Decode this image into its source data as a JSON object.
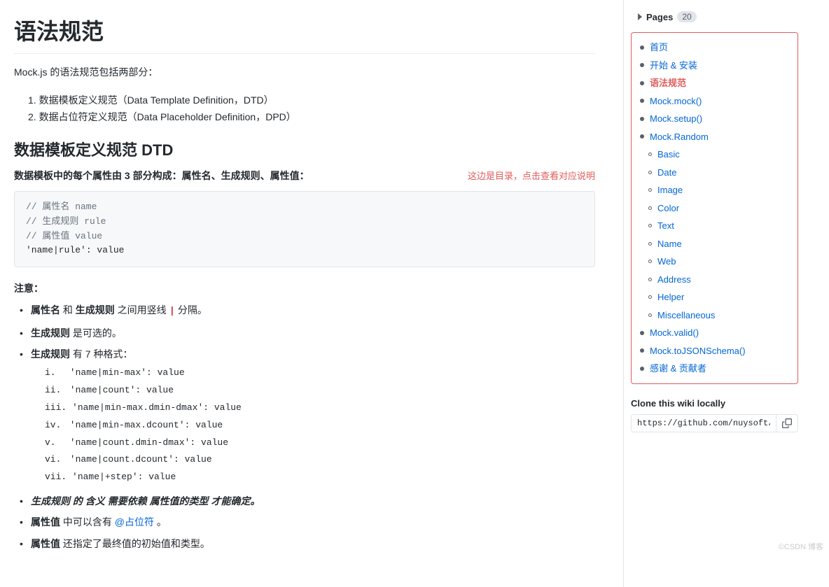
{
  "page": {
    "title": "语法规范",
    "intro": "Mock.js 的语法规范包括两部分：",
    "intro_items": [
      "1. 数据模板定义规范（Data Template Definition，DTD）",
      "2. 数据占位符定义规范（Data Placeholder Definition，DPD）"
    ],
    "section1_title": "数据模板定义规范 DTD",
    "section1_highlight": "数据模板中的每个属性由 3 部分构成：属性名、生成规则、属性值：",
    "toc_hint": "这边是目录，点击查看对应说明",
    "code_lines": [
      "// 属性名   name",
      "// 生成规则 rule",
      "// 属性值   value",
      "'name|rule': value"
    ],
    "note_label": "注意：",
    "notes": [
      "属性名 和 生成规则 之间用竖线 | 分隔。",
      "生成规则 是可选的。",
      "生成规则 有 7 种格式："
    ],
    "rule_formats": [
      {
        "roman": "i.",
        "code": "'name|min-max': value"
      },
      {
        "roman": "ii.",
        "code": "'name|count': value"
      },
      {
        "roman": "iii.",
        "code": "'name|min-max.dmin-dmax': value"
      },
      {
        "roman": "iv.",
        "code": "'name|min-max.dcount': value"
      },
      {
        "roman": "v.",
        "code": "'name|count.dmin-dmax': value"
      },
      {
        "roman": "vi.",
        "code": "'name|count.dcount': value"
      },
      {
        "roman": "vii.",
        "code": "'name|+step': value"
      }
    ],
    "notes2": [
      {
        "text": "生成规则 的 含义 需要依赖 属性值的类型 才能确定。",
        "italic": true
      },
      {
        "text": "属性值 中可以含有 @占位符 。",
        "italic": false
      },
      {
        "text": "属性值 还指定了最终值的初始值和类型。",
        "italic": false
      }
    ]
  },
  "sidebar": {
    "pages_label": "Pages",
    "pages_count": "20",
    "nav_items": [
      {
        "id": "home",
        "label": "首页",
        "level": "top",
        "active": false
      },
      {
        "id": "start",
        "label": "开始 & 安装",
        "level": "top",
        "active": false
      },
      {
        "id": "syntax",
        "label": "语法规范",
        "level": "top",
        "active": true
      },
      {
        "id": "mock-mock",
        "label": "Mock.mock()",
        "level": "top",
        "active": false
      },
      {
        "id": "mock-setup",
        "label": "Mock.setup()",
        "level": "top",
        "active": false
      },
      {
        "id": "mock-random",
        "label": "Mock.Random",
        "level": "top",
        "active": false
      },
      {
        "id": "basic",
        "label": "Basic",
        "level": "sub",
        "active": false
      },
      {
        "id": "date",
        "label": "Date",
        "level": "sub",
        "active": false
      },
      {
        "id": "image",
        "label": "Image",
        "level": "sub",
        "active": false
      },
      {
        "id": "color",
        "label": "Color",
        "level": "sub",
        "active": false
      },
      {
        "id": "text",
        "label": "Text",
        "level": "sub",
        "active": false
      },
      {
        "id": "name",
        "label": "Name",
        "level": "sub",
        "active": false
      },
      {
        "id": "web",
        "label": "Web",
        "level": "sub",
        "active": false
      },
      {
        "id": "address",
        "label": "Address",
        "level": "sub",
        "active": false
      },
      {
        "id": "helper",
        "label": "Helper",
        "level": "sub",
        "active": false
      },
      {
        "id": "miscellaneous",
        "label": "Miscellaneous",
        "level": "sub",
        "active": false
      },
      {
        "id": "mock-valid",
        "label": "Mock.valid()",
        "level": "top",
        "active": false
      },
      {
        "id": "mock-tojsonschema",
        "label": "Mock.toJSONSchema()",
        "level": "top",
        "active": false
      },
      {
        "id": "thanks",
        "label": "感谢 & 贡献者",
        "level": "top",
        "active": false
      }
    ],
    "clone_title": "Clone this wiki locally",
    "clone_url": "https://github.com/nuysoft/Mock."
  },
  "watermark": "©CSDN 博客"
}
